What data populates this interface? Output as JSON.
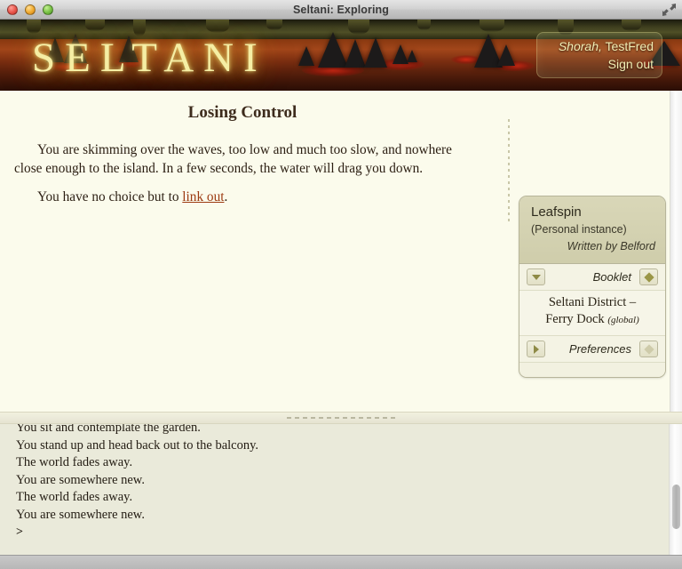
{
  "window": {
    "title": "Seltani: Exploring",
    "controls": {
      "close": "close",
      "minimize": "minimize",
      "zoom": "zoom"
    },
    "fullscreen_label": "Enter full screen"
  },
  "banner": {
    "logo": "SELTANI",
    "greeting_prefix": "Shorah,",
    "username": "TestFred",
    "signout_label": "Sign out"
  },
  "story": {
    "title": "Losing Control",
    "paragraph1": "You are skimming over the waves, too low and much too slow, and nowhere close enough to the island. In a few seconds, the water will drag you down.",
    "paragraph2_before": "You have no choice but to ",
    "paragraph2_link": "link out",
    "paragraph2_after": "."
  },
  "panel": {
    "instance_title": "Leafspin",
    "instance_kind": "(Personal instance)",
    "author_line": "Written by Belford",
    "booklet": {
      "label": "Booklet",
      "toggle_icon": "triangle-down-icon",
      "state": "expanded",
      "marker_icon": "diamond-filled-icon",
      "location_line1": "Seltani District –",
      "location_line2": "Ferry Dock",
      "location_scope": "(global)"
    },
    "preferences": {
      "label": "Preferences",
      "toggle_icon": "triangle-right-icon",
      "state": "collapsed",
      "marker_icon": "diamond-pale-icon"
    }
  },
  "console": {
    "lines": [
      "You sit and contemplate the garden.",
      "You stand up and head back out to the balcony.",
      "The world fades away.",
      "You are somewhere new.",
      "The world fades away.",
      "You are somewhere new."
    ],
    "prompt": ">"
  },
  "colors": {
    "page_bg": "#fbfbec",
    "console_bg": "#eaeada",
    "link": "#9c3a10",
    "logo": "#f5eea4",
    "panel_head": "#d5d3b2",
    "accent_green": "#9a9647"
  }
}
